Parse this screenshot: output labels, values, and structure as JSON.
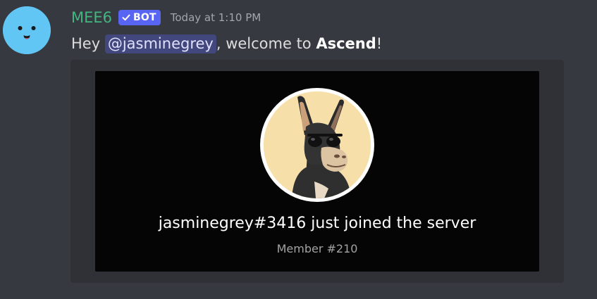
{
  "message": {
    "author": {
      "name": "MEE6",
      "name_color": "#43b581",
      "avatar_icon": "mee6-face-icon",
      "bot_tag": "BOT",
      "bot_tag_color": "#5865f2"
    },
    "timestamp": "Today at 1:10 PM",
    "content": {
      "greeting": "Hey ",
      "mention": "@jasminegrey",
      "middle": ", welcome to ",
      "server": "Ascend",
      "end": "!"
    }
  },
  "embed": {
    "background": "#2f3136",
    "card": {
      "background": "#050506",
      "profile_icon": "donkey-with-sunglasses-avatar",
      "joined_text": "jasminegrey#3416 just joined the server",
      "member_text": "Member #210"
    }
  }
}
